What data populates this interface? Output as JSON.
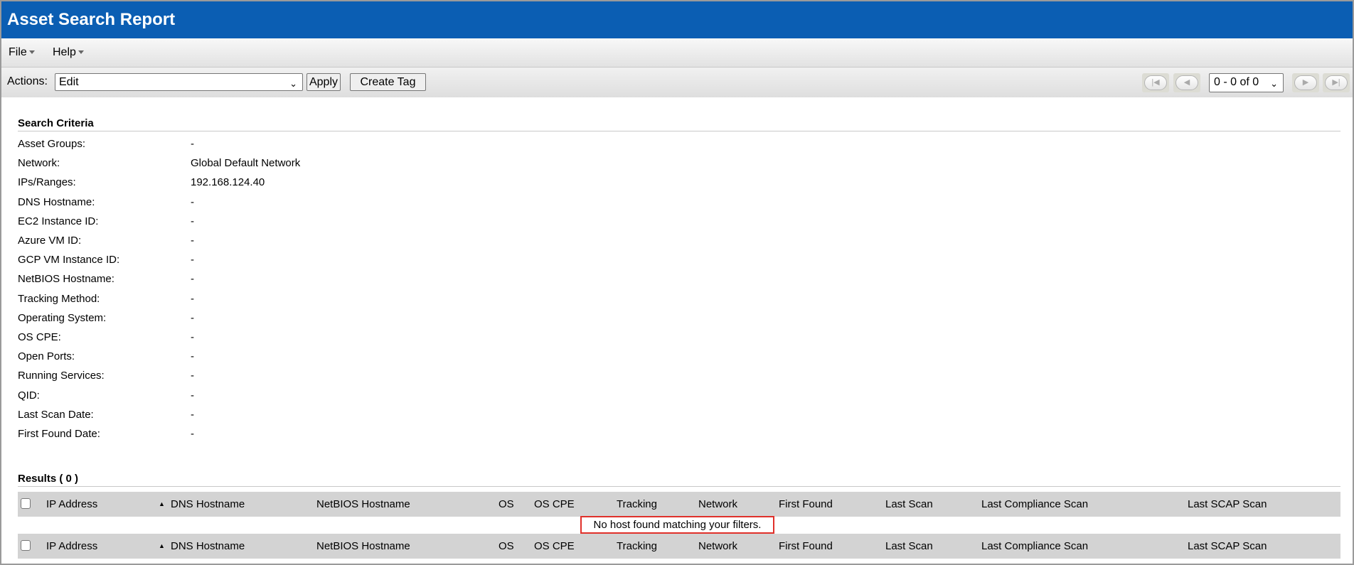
{
  "title": "Asset Search Report",
  "menu": {
    "file": "File",
    "help": "Help"
  },
  "toolbar": {
    "actions_label": "Actions:",
    "actions_value": "Edit",
    "apply": "Apply",
    "create_tag": "Create Tag",
    "pager_value": "0 - 0 of 0"
  },
  "criteria": {
    "heading": "Search Criteria",
    "rows": [
      {
        "label": "Asset Groups:",
        "value": "-"
      },
      {
        "label": "Network:",
        "value": "Global Default Network"
      },
      {
        "label": "IPs/Ranges:",
        "value": "192.168.124.40"
      },
      {
        "label": "DNS Hostname:",
        "value": "-"
      },
      {
        "label": "EC2 Instance ID:",
        "value": "-"
      },
      {
        "label": "Azure VM ID:",
        "value": "-"
      },
      {
        "label": "GCP VM Instance ID:",
        "value": "-"
      },
      {
        "label": "NetBIOS Hostname:",
        "value": "-"
      },
      {
        "label": "Tracking Method:",
        "value": "-"
      },
      {
        "label": "Operating System:",
        "value": "-"
      },
      {
        "label": "OS CPE:",
        "value": "-"
      },
      {
        "label": "Open Ports:",
        "value": "-"
      },
      {
        "label": "Running Services:",
        "value": "-"
      },
      {
        "label": "QID:",
        "value": "-"
      },
      {
        "label": "Last Scan Date:",
        "value": "-"
      },
      {
        "label": "First Found Date:",
        "value": "-"
      }
    ]
  },
  "results": {
    "heading": "Results ( 0 )",
    "columns": [
      "IP Address",
      "DNS Hostname",
      "NetBIOS Hostname",
      "OS",
      "OS CPE",
      "Tracking",
      "Network",
      "First Found",
      "Last Scan",
      "Last Compliance Scan",
      "Last SCAP Scan"
    ],
    "sort_column": "DNS Hostname",
    "empty_message": "No host found matching your filters."
  },
  "colors": {
    "title_bar": "#0b5eb3",
    "highlight_border": "#e0302a"
  }
}
